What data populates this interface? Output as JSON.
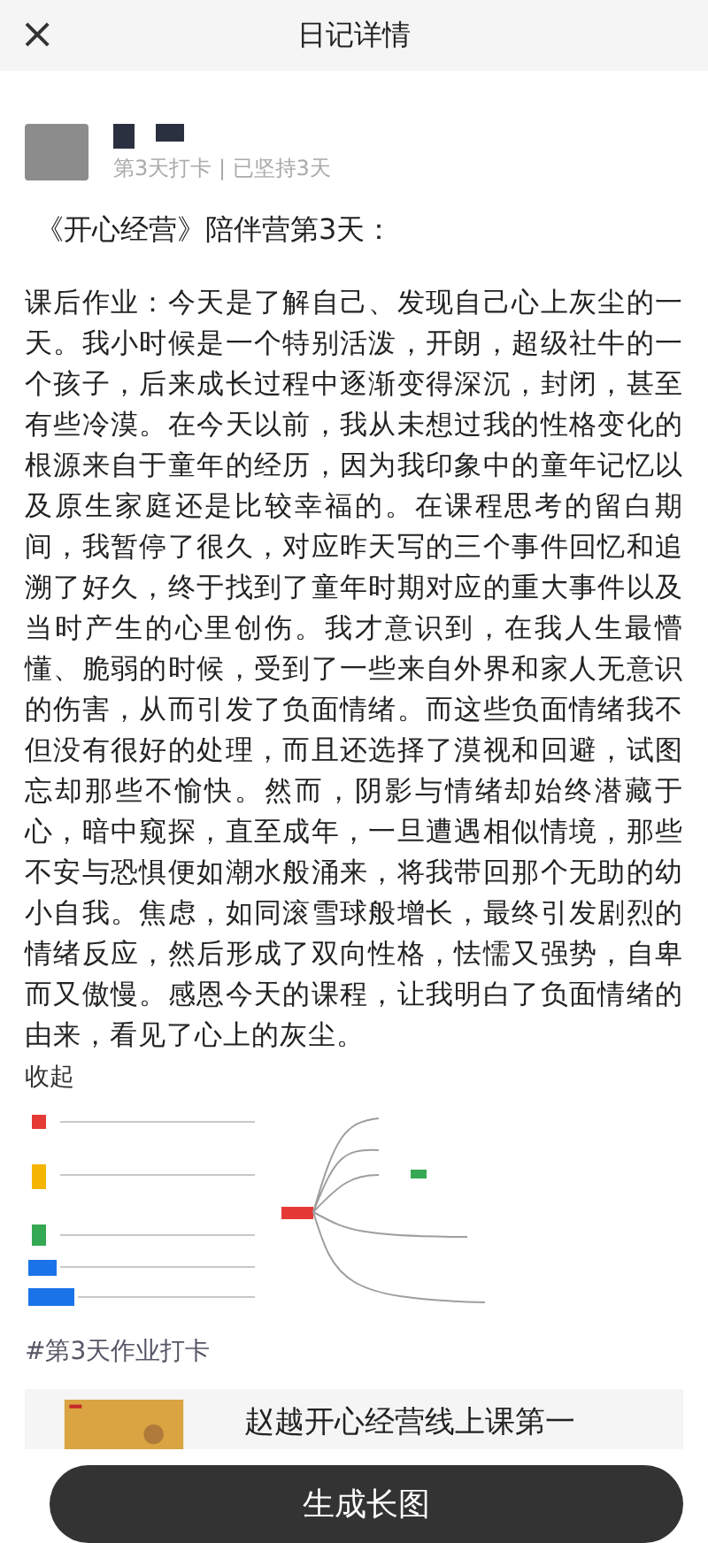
{
  "header": {
    "title": "日记详情",
    "close": "×"
  },
  "post": {
    "meta": "第3天打卡 | 已坚持3天",
    "title": "《开心经营》陪伴营第3天：",
    "body": "课后作业：今天是了解自己、发现自己心上灰尘的一天。我小时候是一个特别活泼，开朗，超级社牛的一个孩子，后来成长过程中逐渐变得深沉，封闭，甚至有些冷漠。在今天以前，我从未想过我的性格变化的根源来自于童年的经历，因为我印象中的童年记忆以及原生家庭还是比较幸福的。在课程思考的留白期间，我暂停了很久，对应昨天写的三个事件回忆和追溯了好久，终于找到了童年时期对应的重大事件以及当时产生的心里创伤。我才意识到，在我人生最懵懂、脆弱的时候，受到了一些来自外界和家人无意识的伤害，从而引发了负面情绪。而这些负面情绪我不但没有很好的处理，而且还选择了漠视和回避，试图忘却那些不愉快。然而，阴影与情绪却始终潜藏于心，暗中窥探，直至成年，一旦遭遇相似情境，那些不安与恐惧便如潮水般涌来，将我带回那个无助的幼小自我。焦虑，如同滚雪球般增长，最终引发剧烈的情绪反应，然后形成了双向性格，怯懦又强势，自卑而又傲慢。感恩今天的课程，让我明白了负面情绪的由来，看见了心上的灰尘。",
    "collapse": "收起",
    "hashtag": "#第3天作业打卡"
  },
  "course_card": {
    "title": "赵越开心经营线上课第一"
  },
  "action_button": "生成长图"
}
